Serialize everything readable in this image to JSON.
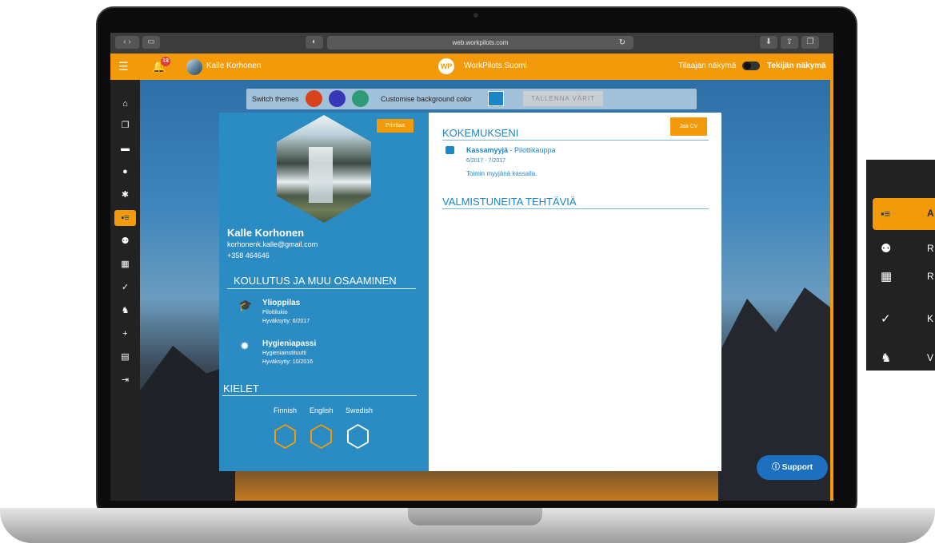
{
  "browser": {
    "url": "web.workpilots.com",
    "reload_icon": "reload-icon"
  },
  "header": {
    "notifications_count": "18",
    "user_name": "Kalle Korhonen",
    "brand_name": "WorkPilots Suomi",
    "view_client_label": "Tilaajan näkymä",
    "view_worker_label": "Tekijän näkymä"
  },
  "theme_bar": {
    "switch_label": "Switch themes",
    "swatches": [
      "#d8431c",
      "#3a36b8",
      "#2e9a78"
    ],
    "background_label": "Customise background color",
    "background_color": "#1d86c6",
    "save_label": "TALLENNA VÄRIT"
  },
  "profile": {
    "print_label": "Printtaa",
    "name": "Kalle Korhonen",
    "email": "korhonenk.kalle@gmail.com",
    "phone": "+358 464646",
    "education_heading": "KOULUTUS JA MUU OSAAMINEN",
    "education": [
      {
        "title": "Ylioppilas",
        "school": "Pilottilukio",
        "approved": "Hyväksytty: 6/2017",
        "icon": "graduation-cap-icon"
      },
      {
        "title": "Hygieniapassi",
        "school": "Hygieniainstituutti",
        "approved": "Hyväksytty: 10/2016",
        "icon": "badge-icon"
      }
    ],
    "languages_heading": "KIELET",
    "languages": [
      "Finnish",
      "English",
      "Swedish"
    ]
  },
  "experience": {
    "share_label": "Jaa CV",
    "heading": "KOKEMUKSENI",
    "jobs": [
      {
        "role": "Kassamyyjä",
        "employer": " - Pilottikauppa",
        "dates": "6/2017 - 7/2017",
        "description": "Toimin myyjänä kassalla."
      }
    ],
    "completed_heading": "VALMISTUNEITA TEHTÄVIÄ"
  },
  "support_label": "Support",
  "zoom_menu": {
    "items": [
      {
        "icon": "cv-icon",
        "label": "A"
      },
      {
        "icon": "group-icon",
        "label": "R"
      },
      {
        "icon": "chart-icon",
        "label": "R"
      },
      {
        "icon": "user-check-icon",
        "label": "K"
      },
      {
        "icon": "person-list-icon",
        "label": "V"
      }
    ]
  },
  "colors": {
    "accent": "#f39a0b",
    "primary": "#1d86c6",
    "sidebar": "#222222"
  }
}
